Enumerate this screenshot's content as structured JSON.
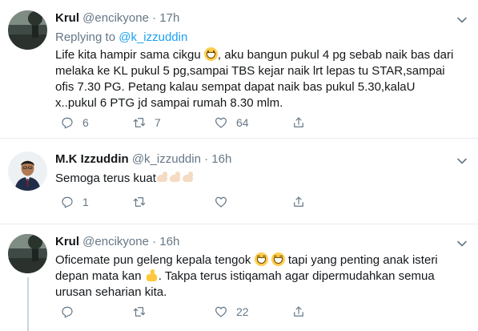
{
  "colors": {
    "text": "#14171a",
    "muted": "#657786",
    "link": "#1da1f2",
    "divider": "#e6ecf0",
    "thread_line": "#ccd6dd"
  },
  "tweets": [
    {
      "name": "Krul",
      "handle": "@encikyone",
      "separator": "·",
      "time": "17h",
      "replying_prefix": "Replying to",
      "replying_to": "@k_izzuddin",
      "text_parts": [
        "Life kita hampir sama cikgu ",
        ", aku bangun pukul 4 pg sebab naik bas dari melaka ke KL pukul 5 pg,sampai TBS kejar naik lrt lepas tu STAR,sampai ofis 7.30 PG. Petang kalau sempat dapat naik bas pukul 5.30,kalaU x..pukul 6 PTG jd sampai rumah 8.30 mlm."
      ],
      "emojis": [
        "grinning-face-emoji"
      ],
      "actions": {
        "reply_count": "6",
        "retweet_count": "7",
        "like_count": "64"
      }
    },
    {
      "name": "M.K Izzuddin",
      "handle": "@k_izzuddin",
      "separator": "·",
      "time": "16h",
      "text_parts": [
        "Semoga terus kuat"
      ],
      "emojis": [
        "flexed-biceps-emoji",
        "flexed-biceps-emoji",
        "flexed-biceps-emoji"
      ],
      "actions": {
        "reply_count": "1",
        "retweet_count": "",
        "like_count": ""
      }
    },
    {
      "name": "Krul",
      "handle": "@encikyone",
      "separator": "·",
      "time": "16h",
      "text_parts": [
        "Oficemate pun geleng kepala tengok ",
        " tapi yang penting anak isteri depan mata kan ",
        ". Takpa terus istiqamah agar dipermudahkan semua urusan seharian kita."
      ],
      "emojis": [
        "laughing-face-emoji",
        "laughing-face-emoji",
        "thumbs-up-emoji"
      ],
      "actions": {
        "reply_count": "",
        "retweet_count": "",
        "like_count": "22"
      }
    }
  ]
}
